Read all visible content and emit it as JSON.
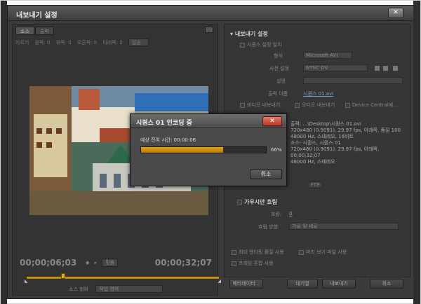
{
  "window": {
    "title": "내보내기 설정",
    "close": "✕"
  },
  "source": {
    "tabs": [
      "소스",
      "출력"
    ],
    "crop_row": [
      "자르기",
      "왼쪽: 0",
      "위쪽: 0",
      "오른쪽: 0",
      "아래쪽: 0"
    ],
    "crop_select": "없음",
    "timecode_in": "00;00;06;03",
    "timecode_out": "00;00;32;07",
    "fit": "맞춤",
    "source_range_label": "소스 범위",
    "source_range_value": "작업 영역",
    "playhead_progress": 0.18,
    "marker_in": "◣",
    "marker_out": "◢"
  },
  "export": {
    "section_title": "내보내기 설정",
    "match_sequence": "시퀀스 설정 일치",
    "format_label": "형식",
    "format_value": "Microsoft AVI",
    "preset_label": "사전 설정",
    "preset_value": "NTSC DV",
    "comment_label": "설명",
    "output_label": "출력 이름",
    "output_value": "시퀀스 01.avi",
    "export_video": "비디오 내보내기",
    "export_audio": "오디오 내보내기",
    "device_central": "Device Central에…",
    "summary_title": "요약",
    "summary_lines": [
      "출력: ...\\Desktop\\시퀀스 01.avi",
      "720x480 (0.9091), 29.97 fps, 아래쪽, 품질 100",
      "48000 Hz, 스테레오, 16비트",
      "",
      "소스: 시퀀스, 시퀀스 01",
      "720x480 (0.9091), 29.97 fps, 아래쪽, 00;00;32;07",
      "48000 Hz, 스테레오"
    ],
    "tab_ftp": "FTP",
    "gaussian_title": "가우시안 흐림",
    "blur_label": "흐림:",
    "blur_value": "0",
    "blur_dir_label": "흐림 방향:",
    "blur_dir_value": "가로 및 세로",
    "max_render": "최대 렌더링 품질 사용",
    "use_preview": "미리 보기 파일 사용",
    "frame_blend": "프레임 혼합 사용"
  },
  "buttons": {
    "metadata": "메타데이터...",
    "queue": "대기열",
    "export": "내보내기",
    "cancel": "취소"
  },
  "encoding_dialog": {
    "title": "시퀀스 01 인코딩 중",
    "close": "✕",
    "remaining": "예상 잔여 시간: 00:00:06",
    "progress": 66,
    "progress_label": "66%",
    "cancel": "취소"
  },
  "colors": {
    "accent": "#e4a418",
    "close_red": "#c44a3a"
  }
}
